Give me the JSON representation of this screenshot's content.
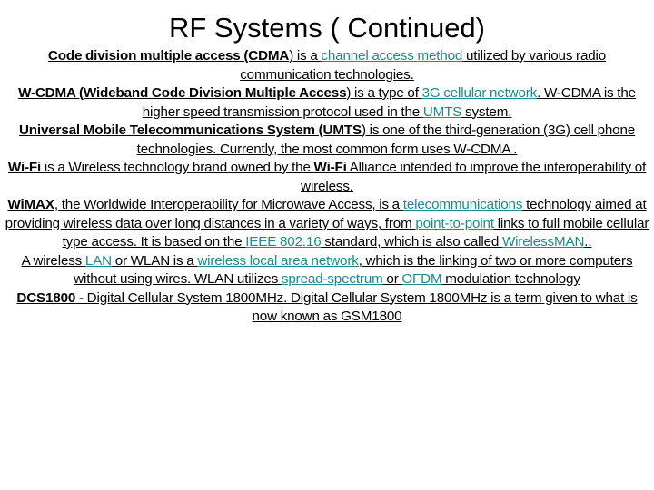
{
  "slide": {
    "title": "RF Systems ( Continued)",
    "link_color": "#1a8a8a",
    "text_color": "#000000",
    "background_color": "#ffffff",
    "paragraphs": [
      {
        "id": "cdma",
        "runs": [
          {
            "text": "Code division multiple access (CDMA",
            "style": "bold"
          },
          {
            "text": ") is a ",
            "style": "plain"
          },
          {
            "text": "channel access method",
            "style": "link"
          },
          {
            "text": " utilized by various radio communication technologies.",
            "style": "plain"
          }
        ]
      },
      {
        "id": "wcdma",
        "runs": [
          {
            "text": "W-CDMA (Wideband Code Division Multiple Access",
            "style": "bold"
          },
          {
            "text": ") is a type of ",
            "style": "plain"
          },
          {
            "text": "3G cellular network",
            "style": "link"
          },
          {
            "text": ". W-CDMA is the higher speed transmission protocol used in  the ",
            "style": "plain"
          },
          {
            "text": "UMTS",
            "style": "link"
          },
          {
            "text": " system.",
            "style": "plain"
          }
        ]
      },
      {
        "id": "umts",
        "runs": [
          {
            "text": "Universal Mobile Telecommunications System (UMTS",
            "style": "bold"
          },
          {
            "text": ") is one of the third-generation (3G) cell phone technologies. Currently, the most common form uses W-CDMA .",
            "style": "plain"
          }
        ]
      },
      {
        "id": "wifi",
        "runs": [
          {
            "text": "Wi-Fi",
            "style": "bold"
          },
          {
            "text": "  is a Wireless technology brand owned by the ",
            "style": "plain"
          },
          {
            "text": "Wi-Fi",
            "style": "bold"
          },
          {
            "text": " Alliance intended to improve the interoperability of wireless.",
            "style": "plain"
          }
        ]
      },
      {
        "id": "wimax",
        "runs": [
          {
            "text": "WiMAX",
            "style": "bold"
          },
          {
            "text": ", the Worldwide Interoperability for Microwave Access, is a ",
            "style": "plain"
          },
          {
            "text": "telecommunications",
            "style": "link"
          },
          {
            "text": " technology aimed at providing wireless data over long distances in a variety of ways, from ",
            "style": "plain"
          },
          {
            "text": "point-to-point",
            "style": "link"
          },
          {
            "text": " links to full mobile cellular type access. It is based on the ",
            "style": "plain"
          },
          {
            "text": "IEEE 802.16",
            "style": "link"
          },
          {
            "text": " standard, which is also called ",
            "style": "plain"
          },
          {
            "text": "WirelessMAN",
            "style": "link"
          },
          {
            "text": "..",
            "style": "plain"
          }
        ]
      },
      {
        "id": "wlan",
        "runs": [
          {
            "text": "A wireless ",
            "style": "plain"
          },
          {
            "text": "LAN",
            "style": "link"
          },
          {
            "text": " or WLAN is a ",
            "style": "plain"
          },
          {
            "text": "wireless local area network",
            "style": "link"
          },
          {
            "text": ", which is the linking of two or more computers without using wires. WLAN utilizes ",
            "style": "plain"
          },
          {
            "text": "spread-spectrum",
            "style": "link"
          },
          {
            "text": " or ",
            "style": "plain"
          },
          {
            "text": "OFDM",
            "style": "link"
          },
          {
            "text": " modulation technology",
            "style": "plain"
          }
        ]
      },
      {
        "id": "dcs1800",
        "runs": [
          {
            "text": "DCS1800",
            "style": "bold"
          },
          {
            "text": " - Digital Cellular System 1800MHz. Digital Cellular System 1800MHz is a term given to what is now known as GSM1800",
            "style": "plain"
          }
        ]
      }
    ]
  }
}
